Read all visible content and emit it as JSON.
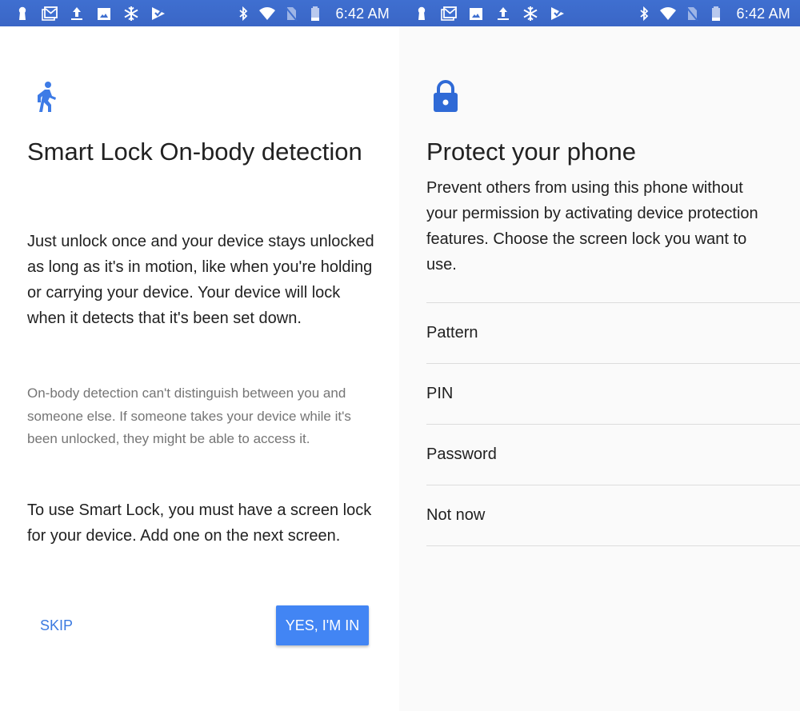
{
  "colors": {
    "status_bar": "#3d6acb",
    "accent": "#4285f4",
    "icon_blue": "#3d7be6",
    "left_bg": "#ffffff",
    "right_bg": "#fafafa"
  },
  "status_bar": {
    "left_screen": {
      "notification_icons": [
        "keyhole-icon",
        "gmail-icon",
        "upload-icon",
        "image-icon",
        "snowflake-icon",
        "checklist-icon"
      ],
      "system_icons": [
        "bluetooth-icon",
        "wifi-icon",
        "no-sim-icon",
        "battery-icon"
      ],
      "time": "6:42 AM"
    },
    "right_screen": {
      "notification_icons": [
        "keyhole-icon",
        "gmail-icon",
        "image-icon",
        "upload-icon",
        "snowflake-icon",
        "checklist-icon"
      ],
      "system_icons": [
        "bluetooth-icon",
        "wifi-icon",
        "no-sim-icon",
        "battery-icon"
      ],
      "time": "6:42 AM"
    }
  },
  "smart_lock_screen": {
    "icon": "walking-person-icon",
    "title": "Smart Lock On-body detection",
    "paragraph_1": "Just unlock once and your device stays unlocked as long as it's in motion, like when you're holding or carrying your device. Your device will lock when it detects that it's been set down.",
    "paragraph_2": "On-body detection can't distinguish between you and someone else. If someone takes your device while it's been unlocked, they might be able to access it.",
    "paragraph_3": "To use Smart Lock, you must have a screen lock for your device. Add one on the next screen.",
    "skip_label": "SKIP",
    "confirm_label": "YES, I'M IN"
  },
  "protect_screen": {
    "icon": "lock-icon",
    "title": "Protect your phone",
    "description": "Prevent others from using this phone without your permission by activating device protection features. Choose the screen lock you want to use.",
    "options": [
      {
        "label": "Pattern"
      },
      {
        "label": "PIN"
      },
      {
        "label": "Password"
      },
      {
        "label": "Not now"
      }
    ]
  }
}
